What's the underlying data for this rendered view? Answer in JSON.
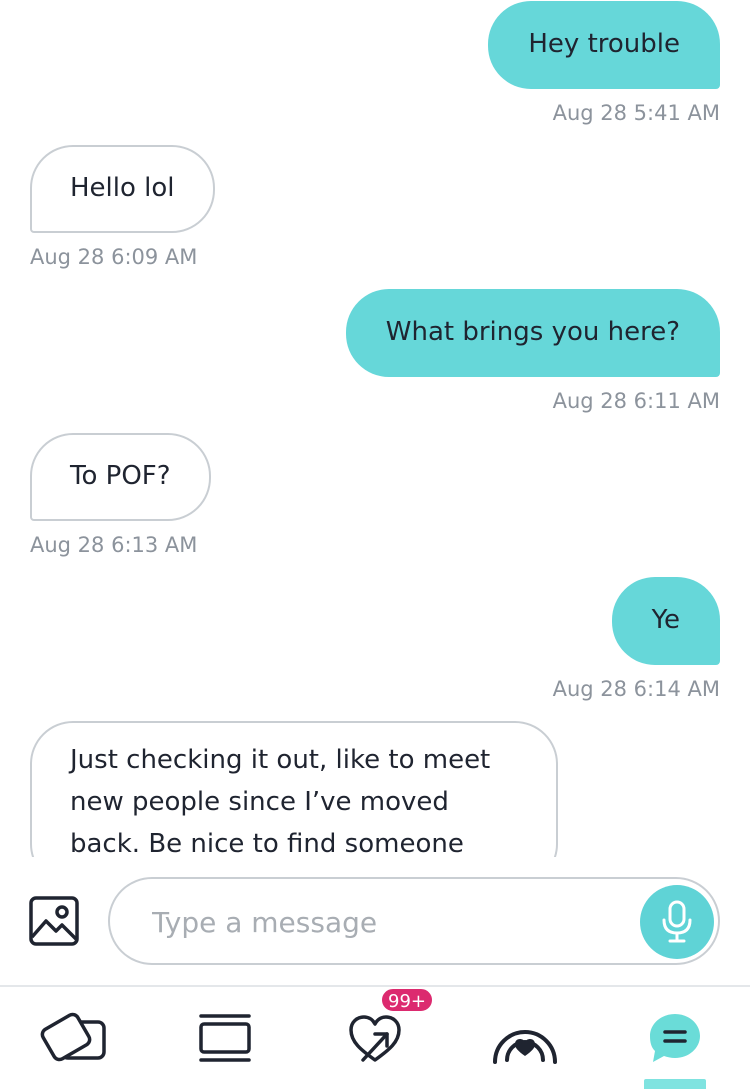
{
  "messages": [
    {
      "side": "out",
      "text": "Hey trouble",
      "time": "Aug 28 5:41 AM"
    },
    {
      "side": "in",
      "text": "Hello lol",
      "time": "Aug 28 6:09 AM"
    },
    {
      "side": "out",
      "text": "What brings you here?",
      "time": "Aug 28 6:11 AM"
    },
    {
      "side": "in",
      "text": "To POF?",
      "time": "Aug 28 6:13 AM"
    },
    {
      "side": "out",
      "text": "Ye",
      "time": "Aug 28 6:14 AM"
    },
    {
      "side": "in",
      "lines": [
        "Just checking it out, like to meet",
        "new people since I’ve moved",
        "back. Be nice to find someone"
      ]
    }
  ],
  "composer": {
    "placeholder": "Type a message",
    "value": "",
    "gallery_icon": "image-icon",
    "mic_icon": "microphone-icon"
  },
  "nav": {
    "items": [
      {
        "icon": "cards-icon",
        "active": false
      },
      {
        "icon": "feed-icon",
        "active": false
      },
      {
        "icon": "heart-arrow-icon",
        "active": false,
        "badge": "99+"
      },
      {
        "icon": "live-icon",
        "active": false
      },
      {
        "icon": "chat-icon",
        "active": true
      }
    ]
  },
  "colors": {
    "outgoing_bubble": "#66d7d9",
    "incoming_border": "#c9ced3",
    "badge": "#dc2a6f",
    "accent": "#5fd3d6",
    "timestamp": "#8c939c"
  }
}
